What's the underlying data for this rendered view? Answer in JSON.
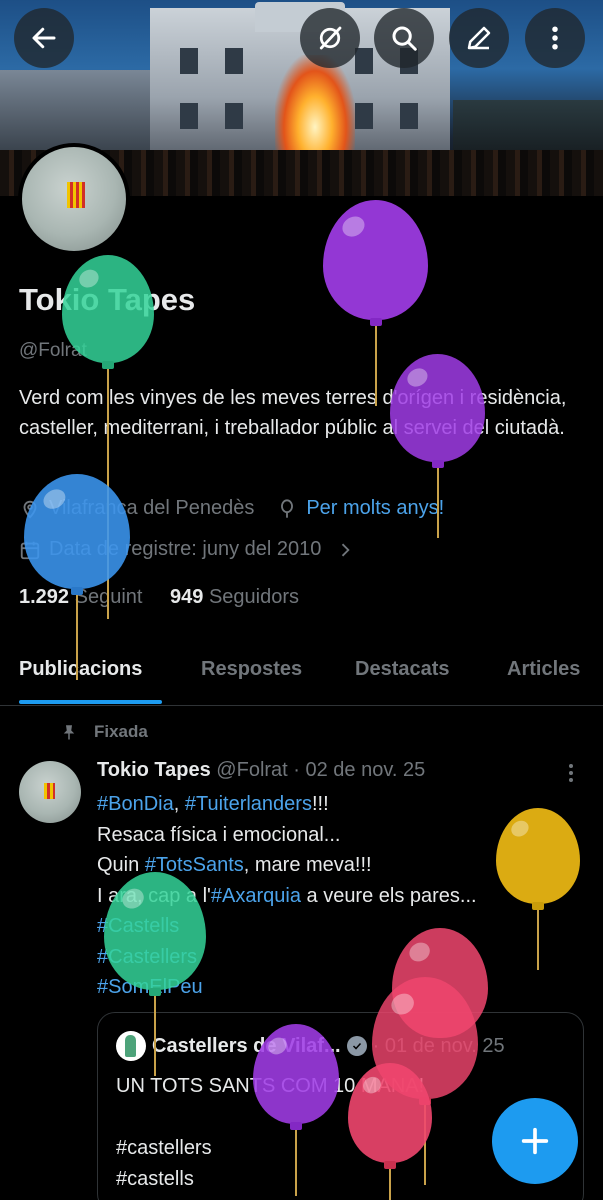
{
  "profile": {
    "name": "Tokio Tapes",
    "handle": "@Folrat",
    "bio": "Verd com les vinyes de les meves terres d'orígen i residència, casteller, mediterrani, i treballador públic al servei del ciutadà.",
    "location": "Vilafranca del Penedès",
    "birthday_link": "Per molts anys!",
    "joined": "Data de registre: juny del 2010",
    "following_count": "1.292",
    "following_label": "Seguint",
    "followers_count": "949",
    "followers_label": "Seguidors"
  },
  "tabs": [
    {
      "label": "Publicacions",
      "active": true
    },
    {
      "label": "Respostes",
      "active": false
    },
    {
      "label": "Destacats",
      "active": false
    },
    {
      "label": "Articles",
      "active": false
    }
  ],
  "post": {
    "pinned_label": "Fixada",
    "author": "Tokio Tapes",
    "handle_date": "@Folrat · 02 de nov. 25",
    "lines": {
      "l1_tag1": "#BonDia",
      "l1_sep": ", ",
      "l1_tag2": "#Tuiterlanders",
      "l1_end": "!!!",
      "l2": "Resaca física i emocional...",
      "l3_pre": "Quin ",
      "l3_tag": "#TotsSants",
      "l3_end": ", mare meva!!!",
      "l4_pre": "I ara, cap a l'",
      "l4_tag": "#Axarquia",
      "l4_end": " a veure els pares...",
      "l5": "#Castells",
      "l6": "#Castellers",
      "l7": "#SomElPeu"
    },
    "quote": {
      "author": "Castellers de Vilaf...",
      "date": "· 01 de nov. 25",
      "line1": "UN TOTS SANTS COM 10 MANA!",
      "line2": "#castellers",
      "line3": "#castells"
    }
  },
  "icons": [
    "back-arrow-icon",
    "translate-off-icon",
    "search-icon",
    "edit-icon",
    "more-vertical-icon",
    "location-icon",
    "balloon-icon",
    "calendar-icon",
    "chevron-right-icon",
    "pin-icon",
    "plus-icon",
    "verified-icon"
  ],
  "colors": {
    "accent": "#1d9bf0",
    "link": "#4ca3ea",
    "muted": "#71767b",
    "background": "#000000"
  }
}
